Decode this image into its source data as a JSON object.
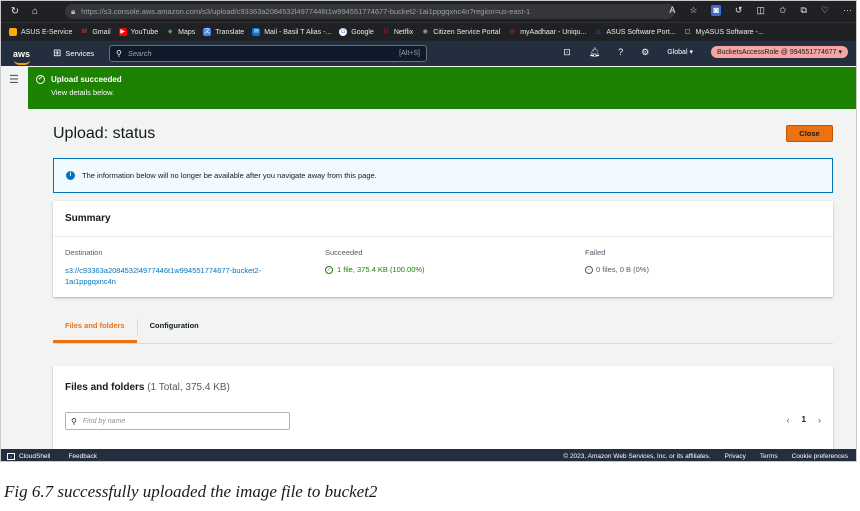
{
  "browser": {
    "url": "https://s3.console.aws.amazon.com/s3/upload/c93363a2084532l4977446t1w994551774677-bucket2-1ai1ppgqxnc4n?region=us-east-1",
    "bookmarks": [
      {
        "label": "ASUS E-Service",
        "color": "#f9ab00",
        "glyph": "▪"
      },
      {
        "label": "Gmail",
        "color": "#ea4335",
        "glyph": "M"
      },
      {
        "label": "YouTube",
        "color": "#ff0000",
        "glyph": "▶"
      },
      {
        "label": "Maps",
        "color": "#34a853",
        "glyph": "◆"
      },
      {
        "label": "Translate",
        "color": "#4285f4",
        "glyph": "文"
      },
      {
        "label": "Mail - Basil T Alias -...",
        "color": "#0078d4",
        "glyph": "✉"
      },
      {
        "label": "Google",
        "color": "#4285f4",
        "glyph": "G"
      },
      {
        "label": "Netflix",
        "color": "#e50914",
        "glyph": "N"
      },
      {
        "label": "Citizen Service Portal",
        "color": "#5f6368",
        "glyph": "◉"
      },
      {
        "label": "myAadhaar - Uniqu...",
        "color": "#d93025",
        "glyph": "◎"
      },
      {
        "label": "ASUS Software Port...",
        "color": "#1a73e8",
        "glyph": "△"
      },
      {
        "label": "MyASUS Software -...",
        "color": "#5f6368",
        "glyph": "▢"
      }
    ]
  },
  "aws_nav": {
    "logo": "aws",
    "services": "Services",
    "search_placeholder": "Search",
    "search_shortcut": "[Alt+S]",
    "region": "Global ▾",
    "role": "BucketsAccessRole @ 994551774677 ▾"
  },
  "banner": {
    "title": "Upload succeeded",
    "subtitle": "View details below."
  },
  "page": {
    "title": "Upload: status",
    "close_label": "Close",
    "info_message": "The information below will no longer be available after you navigate away from this page."
  },
  "summary": {
    "heading": "Summary",
    "destination_label": "Destination",
    "destination_line1": "s3://c93363a2084532l4977446t1w994551774677-bucket2-",
    "destination_line2": "1ai1ppgqxnc4n",
    "succeeded_label": "Succeeded",
    "succeeded_value": "1 file, 375.4 KB (100.00%)",
    "failed_label": "Failed",
    "failed_value": "0 files, 0 B (0%)"
  },
  "tabs": [
    {
      "label": "Files and folders",
      "active": true
    },
    {
      "label": "Configuration",
      "active": false
    }
  ],
  "files_panel": {
    "heading": "Files and folders",
    "count": "(1 Total, 375.4 KB)",
    "find_placeholder": "Find by name",
    "page_number": "1"
  },
  "footer": {
    "cloudshell": "CloudShell",
    "feedback": "Feedback",
    "copyright": "© 2023, Amazon Web Services, Inc. or its affiliates.",
    "privacy": "Privacy",
    "terms": "Terms",
    "cookies": "Cookie preferences"
  },
  "caption": "Fig 6.7 successfully uploaded the image file to bucket2"
}
